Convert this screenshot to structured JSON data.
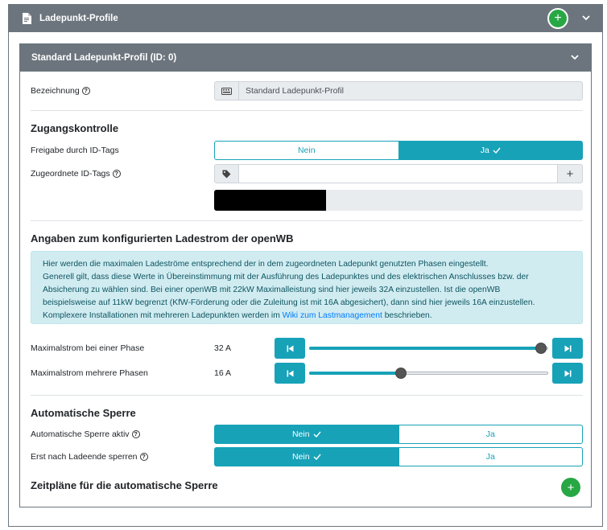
{
  "outer": {
    "title": "Ladepunkt-Profile",
    "add_button": "+"
  },
  "profile": {
    "title": "Standard Ladepunkt-Profil (ID: 0)",
    "bezeichnung_label": "Bezeichnung",
    "bezeichnung_value": "Standard Ladepunkt-Profil"
  },
  "access": {
    "section_title": "Zugangskontrolle",
    "freigabe_label": "Freigabe durch ID-Tags",
    "freigabe_options": [
      "Nein",
      "Ja"
    ],
    "freigabe_selected": "Ja",
    "tags_label": "Zugeordnete ID-Tags",
    "tags_input": "",
    "add_tag": "+"
  },
  "current": {
    "section_title": "Angaben zum konfigurierten Ladestrom der openWB",
    "info_line1": "Hier werden die maximalen Ladeströme entsprechend der in dem zugeordneten Ladepunkt genutzten Phasen eingestellt.",
    "info_line2": "Generell gilt, dass diese Werte in Übereinstimmung mit der Ausführung des Ladepunktes und des elektrischen Anschlusses bzw. der",
    "info_line3": "Absicherung zu wählen sind. Bei einer openWB mit 22kW Maximalleistung sind hier jeweils 32A einzustellen. Ist die openWB",
    "info_line4": "beispielsweise auf 11kW begrenzt (KfW-Förderung oder die Zuleitung ist mit 16A abgesichert), dann sind hier jeweils 16A einzustellen.",
    "info_line5_pre": "Komplexere Installationen mit mehreren Ladepunkten werden im ",
    "info_link": "Wiki zum Lastmanagement",
    "info_line5_post": " beschrieben.",
    "one_phase": {
      "label": "Maximalstrom bei einer Phase",
      "value": "32 A",
      "fraction": 0.97
    },
    "multi_phase": {
      "label": "Maximalstrom mehrere Phasen",
      "value": "16 A",
      "fraction": 0.385
    }
  },
  "lock": {
    "section_title": "Automatische Sperre",
    "active_label": "Automatische Sperre aktiv",
    "active_options": [
      "Nein",
      "Ja"
    ],
    "active_selected": "Nein",
    "after_label": "Erst nach Ladeende sperren",
    "after_options": [
      "Nein",
      "Ja"
    ],
    "after_selected": "Nein",
    "schedules_title": "Zeitpläne für die automatische Sperre",
    "add_schedule": "+"
  },
  "colors": {
    "header": "#6c757d",
    "accent": "#17a2b8",
    "success": "#28a745",
    "info_bg": "#d1ecf1"
  }
}
